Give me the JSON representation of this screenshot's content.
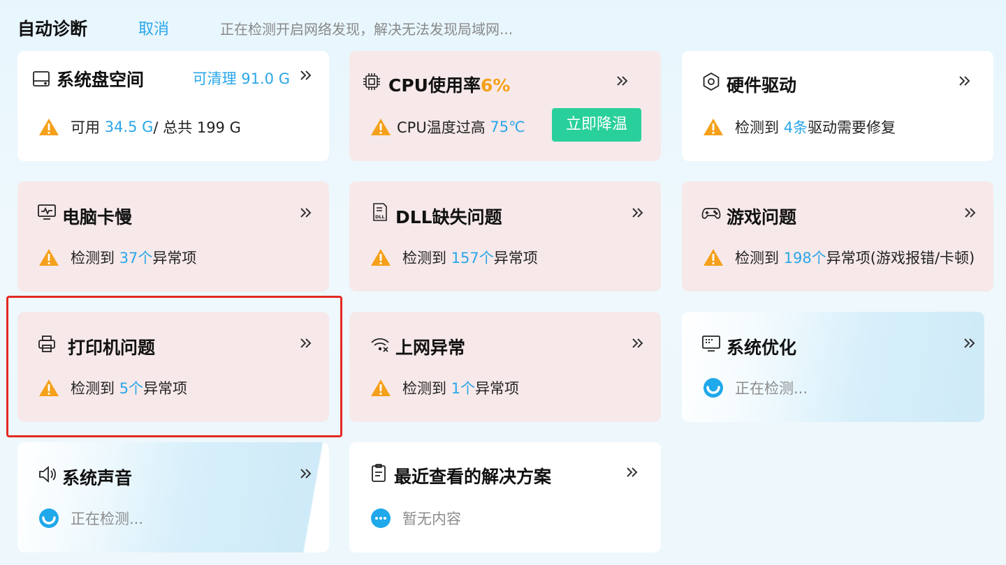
{
  "header": {
    "title": "自动诊断",
    "cancel_label": "取消",
    "status": "正在检测开启网络发现，解决无法发现局域网..."
  },
  "colors": {
    "accent": "#2aa6e8",
    "warning": "#f5a01a",
    "success_button": "#2ad09b",
    "highlight": "#e32a22"
  },
  "cards": {
    "disk": {
      "title": "系统盘空间",
      "icon": "hard-drive-icon",
      "clean_label": "可清理 91.0 G",
      "line_prefix": "可用 ",
      "available": "34.5 G",
      "line_mid": " / 总共 199 G"
    },
    "cpu": {
      "title": "CPU使用率",
      "usage": "6%",
      "icon": "cpu-chip-icon",
      "line_prefix": "CPU温度过高 ",
      "temp": "75℃",
      "button_label": "立即降温"
    },
    "driver": {
      "title": "硬件驱动",
      "icon": "hexagon-gear-icon",
      "line_prefix": "检测到 ",
      "count": "4条",
      "line_suffix": " 驱动需要修复"
    },
    "slow": {
      "title": "电脑卡慢",
      "icon": "monitor-pulse-icon",
      "line_prefix": "检测到 ",
      "count": "37个",
      "line_suffix": " 异常项"
    },
    "dll": {
      "title": "DLL缺失问题",
      "icon": "dll-file-icon",
      "line_prefix": "检测到 ",
      "count": "157个",
      "line_suffix": " 异常项"
    },
    "game": {
      "title": "游戏问题",
      "icon": "gamepad-icon",
      "line_prefix": "检测到 ",
      "count": "198个",
      "line_suffix": " 异常项(游戏报错/卡顿)"
    },
    "printer": {
      "title": "打印机问题",
      "icon": "printer-icon",
      "line_prefix": "检测到 ",
      "count": "5个",
      "line_suffix": " 异常项"
    },
    "network": {
      "title": "上网异常",
      "icon": "wifi-error-icon",
      "line_prefix": "检测到 ",
      "count": "1个",
      "line_suffix": " 异常项"
    },
    "optimize": {
      "title": "系统优化",
      "icon": "keyboard-monitor-icon",
      "status": "正在检测..."
    },
    "sound": {
      "title": "系统声音",
      "icon": "speaker-icon",
      "status": "正在检测..."
    },
    "recent": {
      "title": "最近查看的解决方案",
      "icon": "clipboard-icon",
      "status": "暂无内容"
    }
  }
}
